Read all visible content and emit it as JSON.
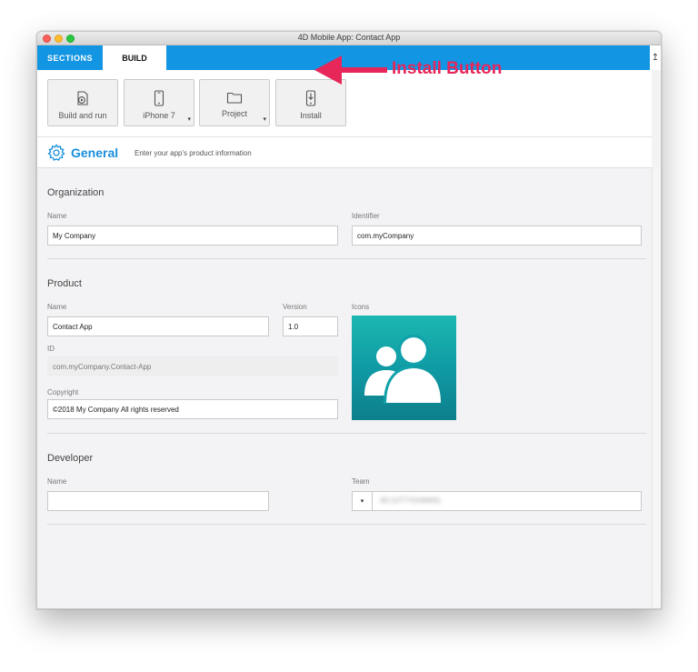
{
  "window": {
    "title": "4D Mobile App: Contact App"
  },
  "tabs": {
    "sections": "SECTIONS",
    "build": "BUILD"
  },
  "toolbar": {
    "build_and_run": "Build and run",
    "device": "iPhone 7",
    "project": "Project",
    "install": "Install"
  },
  "annotation": {
    "text": "Install Button",
    "color": "#e7265a"
  },
  "general": {
    "title": "General",
    "subtitle": "Enter your app's product information"
  },
  "organization": {
    "title": "Organization",
    "name_label": "Name",
    "name_value": "My Company",
    "identifier_label": "Identifier",
    "identifier_value": "com.myCompany"
  },
  "product": {
    "title": "Product",
    "name_label": "Name",
    "name_value": "Contact App",
    "version_label": "Version",
    "version_value": "1.0",
    "icons_label": "Icons",
    "id_label": "ID",
    "id_value": "com.myCompany.Contact-App",
    "copyright_label": "Copyright",
    "copyright_value": "©2018 My Company All rights reserved"
  },
  "developer": {
    "title": "Developer",
    "name_label": "Name",
    "name_value": "",
    "team_label": "Team",
    "team_value": "4D (UT7YDXBW5)"
  },
  "colors": {
    "accent": "#1295e3",
    "title_blue": "#1a8fdd",
    "icon_teal": "#14a8a8"
  }
}
